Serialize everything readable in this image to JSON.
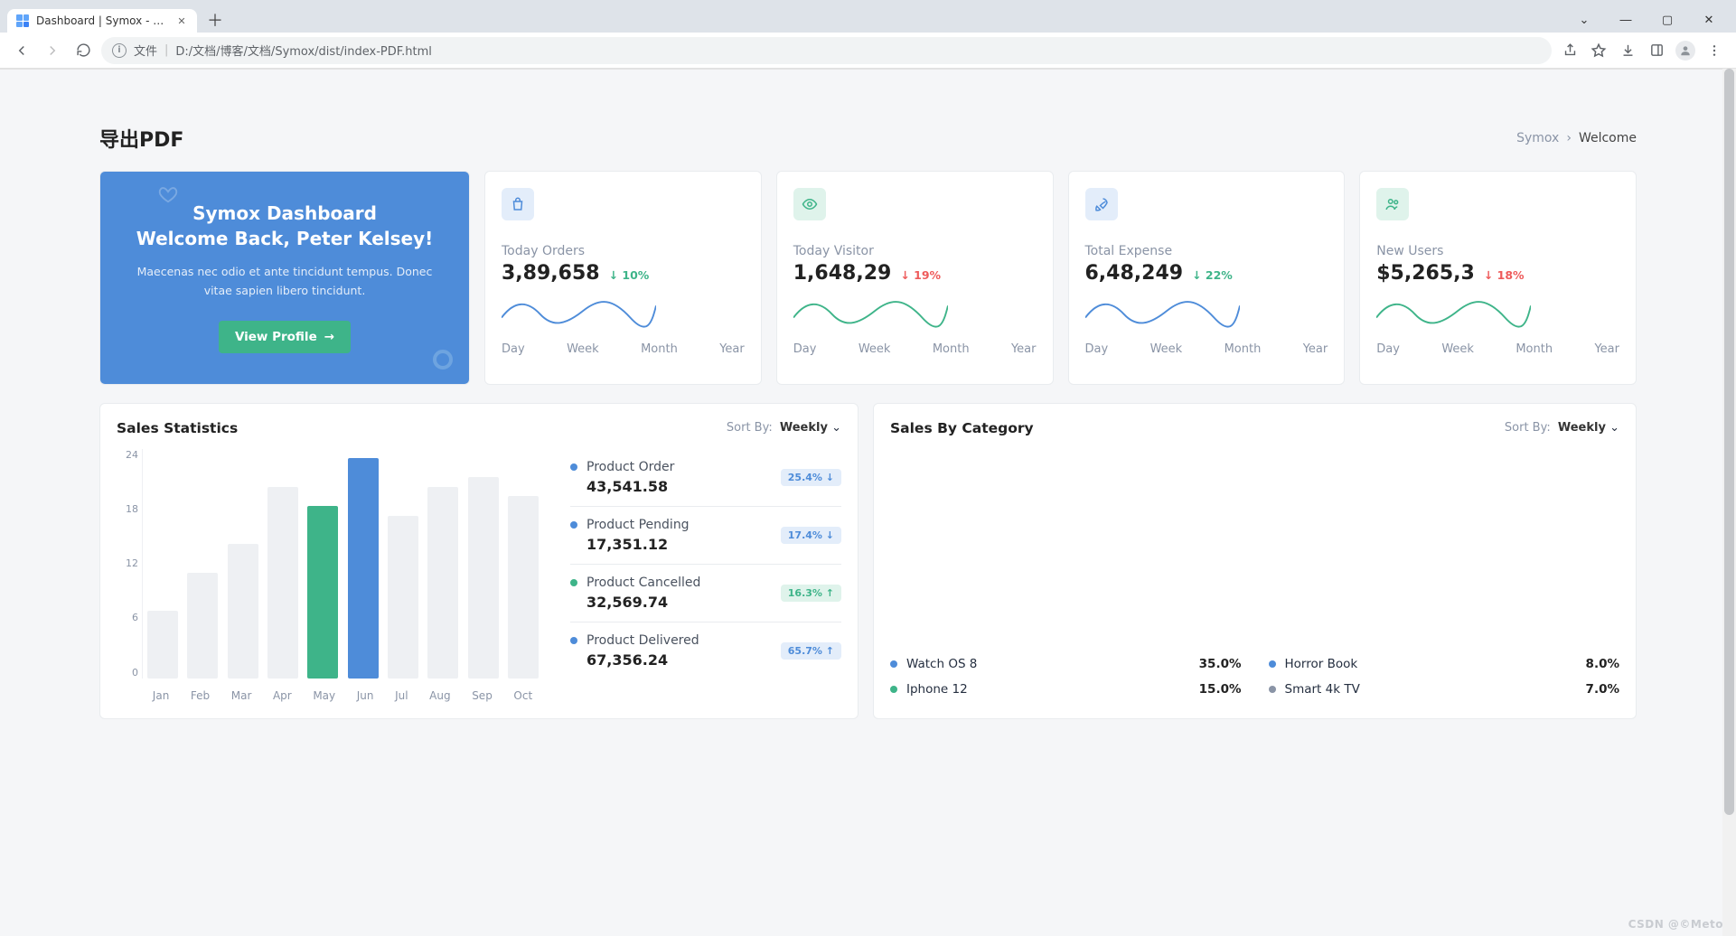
{
  "browser": {
    "tab_title": "Dashboard | Symox - Admin &",
    "url_prefix": "文件",
    "url": "D:/文档/博客/文档/Symox/dist/index-PDF.html"
  },
  "header": {
    "page_title": "导出PDF",
    "breadcrumb_root": "Symox",
    "breadcrumb_here": "Welcome"
  },
  "welcome": {
    "title1": "Symox Dashboard",
    "title2": "Welcome Back, Peter Kelsey!",
    "text": "Maecenas nec odio et ante tincidunt tempus. Donec vitae sapien libero tincidunt.",
    "button": "View Profile"
  },
  "stat_tabs": [
    "Day",
    "Week",
    "Month",
    "Year"
  ],
  "stats": [
    {
      "icon": "bag-icon",
      "wrap": "ic-blue-bg",
      "color": "#4e8cd9",
      "label": "Today Orders",
      "value": "3,89,658",
      "delta": "10%",
      "dir": "up",
      "spark": "#4e8cd9"
    },
    {
      "icon": "eye-icon",
      "wrap": "ic-green-bg",
      "color": "#3eb489",
      "label": "Today Visitor",
      "value": "1,648,29",
      "delta": "19%",
      "dir": "down",
      "spark": "#3eb489"
    },
    {
      "icon": "rocket-icon",
      "wrap": "ic-blue-bg",
      "color": "#4e8cd9",
      "label": "Total Expense",
      "value": "6,48,249",
      "delta": "22%",
      "dir": "up",
      "spark": "#4e8cd9"
    },
    {
      "icon": "users-icon",
      "wrap": "ic-green-bg",
      "color": "#3eb489",
      "label": "New Users",
      "value": "$5,265,3",
      "delta": "18%",
      "dir": "down",
      "spark": "#3eb489"
    }
  ],
  "sales": {
    "title": "Sales Statistics",
    "sort_label": "Sort By:",
    "sort_value": "Weekly",
    "metrics": [
      {
        "dot": "#4e8cd9",
        "label": "Product Order",
        "value": "43,541.58",
        "badge": "25.4%",
        "badge_dir": "down",
        "badge_cls": "blue"
      },
      {
        "dot": "#4e8cd9",
        "label": "Product Pending",
        "value": "17,351.12",
        "badge": "17.4%",
        "badge_dir": "down",
        "badge_cls": "blue"
      },
      {
        "dot": "#3eb489",
        "label": "Product Cancelled",
        "value": "32,569.74",
        "badge": "16.3%",
        "badge_dir": "up",
        "badge_cls": "green"
      },
      {
        "dot": "#4e8cd9",
        "label": "Product Delivered",
        "value": "67,356.24",
        "badge": "65.7%",
        "badge_dir": "up",
        "badge_cls": "blue"
      }
    ]
  },
  "category": {
    "title": "Sales By Category",
    "sort_label": "Sort By:",
    "sort_value": "Weekly",
    "items": [
      {
        "dot": "#4e8cd9",
        "label": "Watch OS 8",
        "pct": "35.0%"
      },
      {
        "dot": "#4e8cd9",
        "label": "Horror Book",
        "pct": "8.0%"
      },
      {
        "dot": "#3eb489",
        "label": "Iphone 12",
        "pct": "15.0%"
      },
      {
        "dot": "#8a94a6",
        "label": "Smart 4k TV",
        "pct": "7.0%"
      }
    ]
  },
  "chart_data": {
    "type": "bar",
    "categories": [
      "Jan",
      "Feb",
      "Mar",
      "Apr",
      "May",
      "Jun",
      "Jul",
      "Aug",
      "Sep",
      "Oct"
    ],
    "values": [
      7,
      11,
      14,
      20,
      18,
      23,
      17,
      20,
      21,
      19
    ],
    "highlights": {
      "May": "#3eb489",
      "Jun": "#4e8cd9"
    },
    "y_ticks": [
      24,
      18,
      12,
      6,
      0
    ],
    "ylim": [
      0,
      24
    ],
    "title": "Sales Statistics"
  },
  "watermark": "CSDN @©Meto"
}
